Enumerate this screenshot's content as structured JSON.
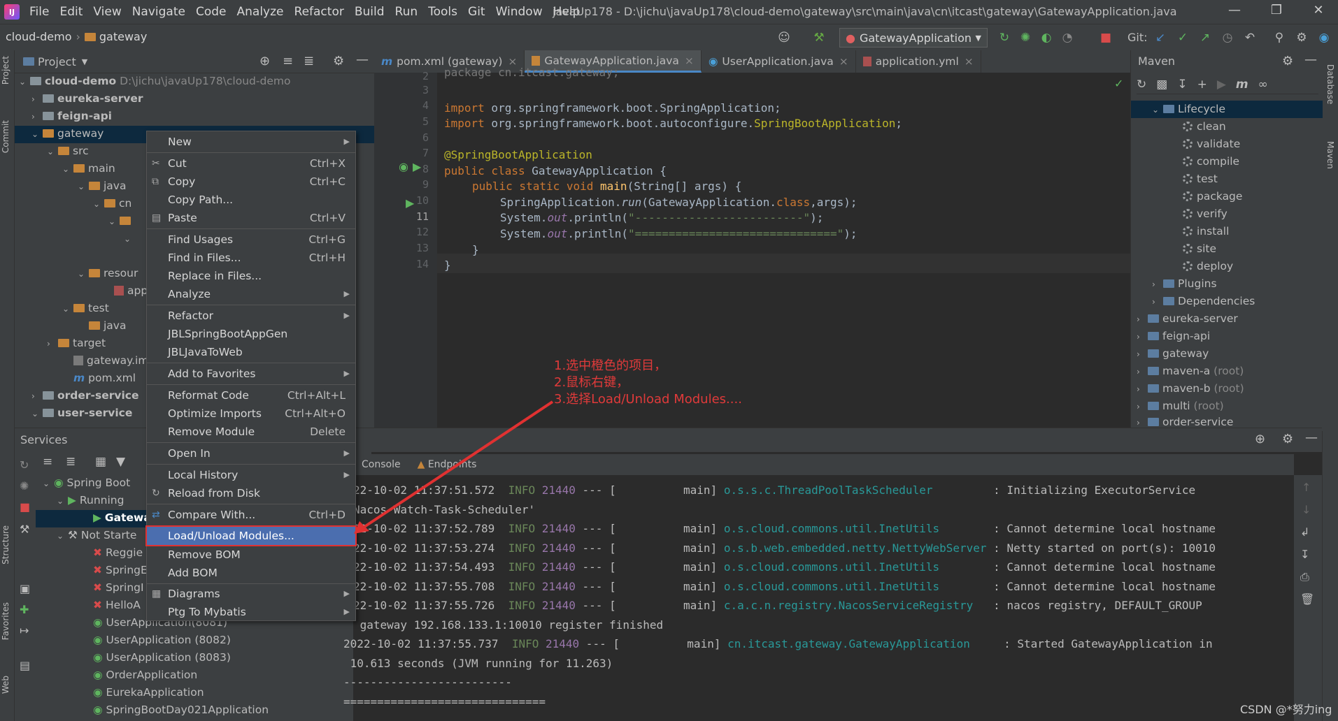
{
  "menubar": {
    "items": [
      "File",
      "Edit",
      "View",
      "Navigate",
      "Code",
      "Analyze",
      "Refactor",
      "Build",
      "Run",
      "Tools",
      "Git",
      "Window",
      "Help"
    ],
    "title": "javaUp178 - D:\\jichu\\javaUp178\\cloud-demo\\gateway\\src\\main\\java\\cn\\itcast\\gateway\\GatewayApplication.java"
  },
  "navbar": {
    "breadcrumb": [
      "cloud-demo",
      "gateway"
    ],
    "run_config": "GatewayApplication",
    "git_label": "Git:"
  },
  "leftstripe": {
    "project": "Project",
    "commit": "Commit",
    "structure": "Structure",
    "favorites": "Favorites",
    "web": "Web"
  },
  "rightstripe": {
    "database": "Database",
    "maven": "Maven"
  },
  "project": {
    "title": "Project",
    "root": "cloud-demo",
    "root_path": "D:\\jichu\\javaUp178\\cloud-demo",
    "items": {
      "eureka": "eureka-server",
      "feign": "feign-api",
      "gateway": "gateway",
      "src": "src",
      "main": "main",
      "java": "java",
      "cn": "cn",
      "resources": "resour",
      "app": "app",
      "test": "test",
      "test_java": "java",
      "target": "target",
      "iml": "gateway.iml",
      "pom": "pom.xml",
      "order": "order-service",
      "user": "user-service"
    }
  },
  "tabs": [
    {
      "label": "pom.xml (gateway)"
    },
    {
      "label": "GatewayApplication.java"
    },
    {
      "label": "UserApplication.java"
    },
    {
      "label": "application.yml"
    }
  ],
  "editor": {
    "line_numbers": [
      "2",
      "3",
      "4",
      "5",
      "6",
      "7",
      "8",
      "9",
      "10",
      "11",
      "12",
      "13",
      "14"
    ],
    "line1_partial": "package cn.itcast.gateway;",
    "import1_kw": "import",
    "import1": " org.springframework.boot.SpringApplication;",
    "import2_kw": "import",
    "import2_a": " org.springframework.boot.autoconfigure.",
    "import2_b": "SpringBootApplication",
    "import2_c": ";",
    "annotation": "@SpringBootApplication",
    "class_kw": "public class",
    "class_name": " GatewayApplication {",
    "main_kw": "public static void",
    "main_fn": " main",
    "main_rest": "(String[] args) {",
    "run_a": "SpringApplication.",
    "run_b": "run",
    "run_c": "(GatewayApplication.",
    "run_d": "class",
    "run_e": ",args);",
    "p1_a": "System.",
    "p1_b": "out",
    "p1_c": ".println(",
    "p1_str": "\"-------------------------\"",
    "p1_d": ");",
    "p2_a": "System.",
    "p2_b": "out",
    "p2_c": ".println(",
    "p2_str": "\"==============================\"",
    "p2_d": ");",
    "close1": "}",
    "close2": "}"
  },
  "maven": {
    "title": "Maven",
    "lifecycle": "Lifecycle",
    "phases": [
      "clean",
      "validate",
      "compile",
      "test",
      "package",
      "verify",
      "install",
      "site",
      "deploy"
    ],
    "plugins": "Plugins",
    "dependencies": "Dependencies",
    "modules": [
      {
        "name": "eureka-server",
        "suffix": ""
      },
      {
        "name": "feign-api",
        "suffix": ""
      },
      {
        "name": "gateway",
        "suffix": ""
      },
      {
        "name": "maven-a",
        "suffix": " (root)"
      },
      {
        "name": "maven-b",
        "suffix": " (root)"
      },
      {
        "name": "multi",
        "suffix": " (root)"
      },
      {
        "name": "order-service",
        "suffix": ""
      }
    ]
  },
  "services": {
    "title": "Services",
    "spring_boot": "Spring Boot",
    "running": "Running",
    "running_app": "Gatewa",
    "not_started": "Not Starte",
    "apps": [
      "Reggie",
      "SpringE",
      "SpringI",
      "HelloA",
      "UserApplication(8081)",
      "UserApplication (8082)",
      "UserApplication (8083)",
      "OrderApplication",
      "EurekaApplication",
      "SpringBootDay021Application"
    ]
  },
  "console": {
    "tab_console": "Console",
    "tab_endpoints": "Endpoints",
    "lines": [
      {
        "date": "22-10-02 11:37:51.572",
        "level": "INFO",
        "pid": "21440",
        "sep": " --- [",
        "thread": "          main]",
        "logger": "o.s.s.c.ThreadPoolTaskScheduler",
        "msg": ": Initializing ExecutorService"
      },
      {
        "raw": "Nacos-Watch-Task-Scheduler'"
      },
      {
        "date": "22-10-02 11:37:52.789",
        "level": "INFO",
        "pid": "21440",
        "sep": " --- [",
        "thread": "          main]",
        "logger": "o.s.cloud.commons.util.InetUtils",
        "msg": ": Cannot determine local hostname"
      },
      {
        "date": "22-10-02 11:37:53.274",
        "level": "INFO",
        "pid": "21440",
        "sep": " --- [",
        "thread": "          main]",
        "logger": "o.s.b.web.embedded.netty.NettyWebServer",
        "msg": ": Netty started on port(s): 10010"
      },
      {
        "date": "22-10-02 11:37:54.493",
        "level": "INFO",
        "pid": "21440",
        "sep": " --- [",
        "thread": "          main]",
        "logger": "o.s.cloud.commons.util.InetUtils",
        "msg": ": Cannot determine local hostname"
      },
      {
        "date": "22-10-02 11:37:55.708",
        "level": "INFO",
        "pid": "21440",
        "sep": " --- [",
        "thread": "          main]",
        "logger": "o.s.cloud.commons.util.InetUtils",
        "msg": ": Cannot determine local hostname"
      },
      {
        "date": "22-10-02 11:37:55.726",
        "level": "INFO",
        "pid": "21440",
        "sep": " --- [",
        "thread": "          main]",
        "logger": "c.a.c.n.registry.NacosServiceRegistry",
        "msg": ": nacos registry, DEFAULT_GROUP"
      },
      {
        "raw": " gateway 192.168.133.1:10010 register finished"
      },
      {
        "date": "2022-10-02 11:37:55.737",
        "level": "INFO",
        "pid": "21440",
        "sep": " --- [",
        "thread": "          main]",
        "logger": "cn.itcast.gateway.GatewayApplication",
        "msg": ": Started GatewayApplication in"
      },
      {
        "raw": " 10.613 seconds (JVM running for 11.263)"
      },
      {
        "raw": "-------------------------"
      },
      {
        "raw": "=============================="
      }
    ]
  },
  "context_menu": {
    "items": [
      {
        "label": "New",
        "shortcut": "",
        "submenu": true
      },
      {
        "label": "Cut",
        "shortcut": "Ctrl+X",
        "icon": "cut-icon"
      },
      {
        "label": "Copy",
        "shortcut": "Ctrl+C",
        "icon": "copy-icon"
      },
      {
        "label": "Copy Path...",
        "shortcut": ""
      },
      {
        "label": "Paste",
        "shortcut": "Ctrl+V",
        "icon": "paste-icon"
      },
      {
        "label": "Find Usages",
        "shortcut": "Ctrl+G"
      },
      {
        "label": "Find in Files...",
        "shortcut": "Ctrl+H"
      },
      {
        "label": "Replace in Files...",
        "shortcut": ""
      },
      {
        "label": "Analyze",
        "shortcut": "",
        "submenu": true
      },
      {
        "label": "Refactor",
        "shortcut": "",
        "submenu": true
      },
      {
        "label": "JBLSpringBootAppGen",
        "shortcut": ""
      },
      {
        "label": "JBLJavaToWeb",
        "shortcut": ""
      },
      {
        "label": "Add to Favorites",
        "shortcut": "",
        "submenu": true
      },
      {
        "label": "Reformat Code",
        "shortcut": "Ctrl+Alt+L"
      },
      {
        "label": "Optimize Imports",
        "shortcut": "Ctrl+Alt+O"
      },
      {
        "label": "Remove Module",
        "shortcut": "Delete"
      },
      {
        "label": "Open In",
        "shortcut": "",
        "submenu": true
      },
      {
        "label": "Local History",
        "shortcut": "",
        "submenu": true
      },
      {
        "label": "Reload from Disk",
        "shortcut": "",
        "icon": "reload-icon"
      },
      {
        "label": "Compare With...",
        "shortcut": "Ctrl+D",
        "icon": "compare-icon"
      },
      {
        "label": "Load/Unload Modules...",
        "shortcut": ""
      },
      {
        "label": "Remove BOM",
        "shortcut": ""
      },
      {
        "label": "Add BOM",
        "shortcut": ""
      },
      {
        "label": "Diagrams",
        "shortcut": "",
        "submenu": true,
        "icon": "diagram-icon"
      },
      {
        "label": "Ptg To Mybatis",
        "shortcut": "",
        "submenu": true
      }
    ]
  },
  "annotation": {
    "line1": "1.选中橙色的项目，",
    "line2": "2.鼠标右键，",
    "line3": "3.选择Load/Unload Modules...."
  },
  "watermark": "CSDN @*努力ing",
  "colors": {
    "annotation": "#e03a3a",
    "highlight": "#4b6eaf",
    "folder": "#c5853a"
  }
}
